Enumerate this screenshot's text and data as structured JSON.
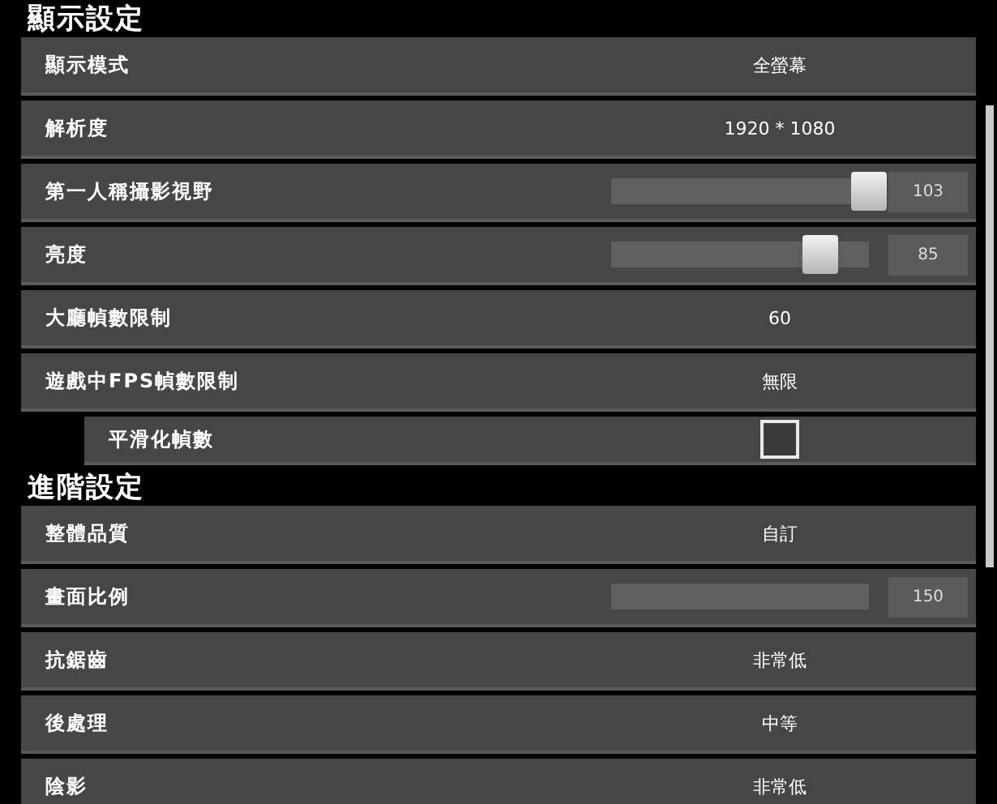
{
  "sections": [
    {
      "title": "顯示設定",
      "rows": [
        {
          "kind": "value",
          "label": "顯示模式",
          "value": "全螢幕"
        },
        {
          "kind": "value",
          "label": "解析度",
          "value": "1920 * 1080"
        },
        {
          "kind": "slider",
          "label": "第一人稱攝影視野",
          "level": 1.0,
          "value": "103"
        },
        {
          "kind": "slider",
          "label": "亮度",
          "level": 0.8,
          "value": "85"
        },
        {
          "kind": "value",
          "label": "大廳幀數限制",
          "value": "60"
        },
        {
          "kind": "value",
          "label": "遊戲中FPS幀數限制",
          "value": "無限"
        },
        {
          "kind": "checkbox",
          "label": "平滑化幀數",
          "checked": false,
          "sub": true
        }
      ]
    },
    {
      "title": "進階設定",
      "rows": [
        {
          "kind": "value",
          "label": "整體品質",
          "value": "自訂"
        },
        {
          "kind": "slider",
          "label": "畫面比例",
          "value": "150"
        },
        {
          "kind": "value",
          "label": "抗鋸齒",
          "value": "非常低"
        },
        {
          "kind": "value",
          "label": "後處理",
          "value": "中等"
        },
        {
          "kind": "value",
          "label": "陰影",
          "value": "非常低"
        }
      ]
    }
  ]
}
